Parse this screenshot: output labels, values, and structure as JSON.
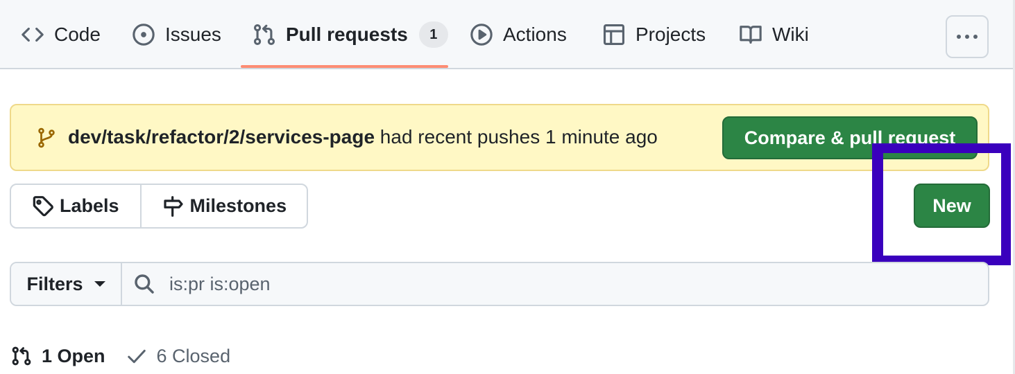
{
  "tabs": [
    {
      "label": "Code",
      "icon": "code-icon"
    },
    {
      "label": "Issues",
      "icon": "issue-opened-icon"
    },
    {
      "label": "Pull requests",
      "icon": "git-pull-request-icon",
      "counter": "1",
      "active": true
    },
    {
      "label": "Actions",
      "icon": "play-icon"
    },
    {
      "label": "Projects",
      "icon": "table-icon"
    },
    {
      "label": "Wiki",
      "icon": "book-icon"
    }
  ],
  "more_button": {
    "icon": "kebab-horizontal-icon"
  },
  "banner": {
    "branch": "dev/task/refactor/2/services-page",
    "message": " had recent pushes 1 minute ago",
    "button_label": "Compare & pull request",
    "background": "#fff8c5"
  },
  "toolbar": {
    "labels_label": "Labels",
    "milestones_label": "Milestones",
    "new_label": "New"
  },
  "filter_bar": {
    "filters_label": "Filters",
    "search_value": "is:pr is:open"
  },
  "states": {
    "open_label": "1 Open",
    "closed_label": "6 Closed"
  },
  "colors": {
    "primary_button": "#2c8545",
    "tab_underline": "#fd8c73",
    "highlight": "#3a00bd"
  }
}
